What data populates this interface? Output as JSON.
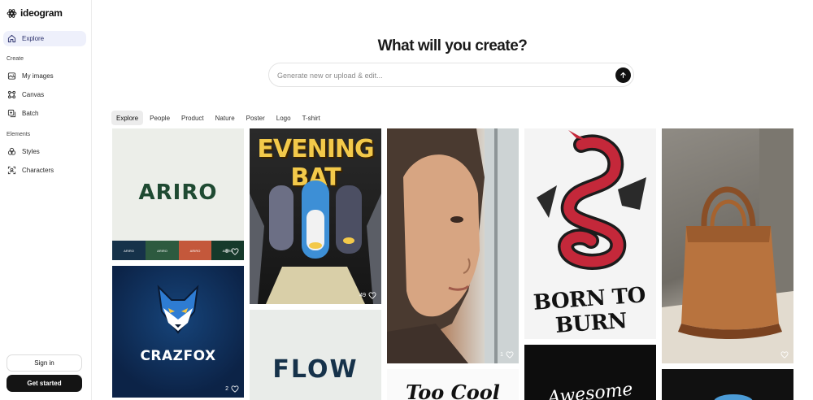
{
  "app": {
    "name": "ideogram"
  },
  "sidebar": {
    "explore": "Explore",
    "create_section": "Create",
    "create_items": [
      "My images",
      "Canvas",
      "Batch"
    ],
    "elements_section": "Elements",
    "elements_items": [
      "Styles",
      "Characters"
    ],
    "sign_in": "Sign in",
    "get_started": "Get started"
  },
  "main": {
    "headline": "What will you create?",
    "prompt_placeholder": "Generate new or upload & edit...",
    "tabs": [
      "Explore",
      "People",
      "Product",
      "Nature",
      "Poster",
      "Logo",
      "T-shirt"
    ],
    "active_tab": "Explore"
  },
  "gallery": [
    {
      "id": "ariro",
      "title_text": "ARIRO",
      "swatches": [
        "ARIRO",
        "ARIRO",
        "ARIRO",
        "ARIRO"
      ],
      "likes": "8"
    },
    {
      "id": "evening-bat",
      "title_text": "EVENING BAT",
      "likes": "49"
    },
    {
      "id": "woman-portrait",
      "likes": "1"
    },
    {
      "id": "dragon",
      "title_text": "BORN TO BURN",
      "likes": ""
    },
    {
      "id": "handbag",
      "likes": ""
    },
    {
      "id": "crazfox",
      "title_text": "CRAZFOX",
      "likes": "2"
    },
    {
      "id": "flow",
      "title_text": "FLOW"
    },
    {
      "id": "too-cool",
      "title_text": "Too Cool"
    },
    {
      "id": "script-card",
      "title_text": "Awesome"
    }
  ],
  "colors": {
    "accent": "#2a2f6b",
    "active_nav_bg": "#eef0fb",
    "button_dark": "#141414"
  }
}
